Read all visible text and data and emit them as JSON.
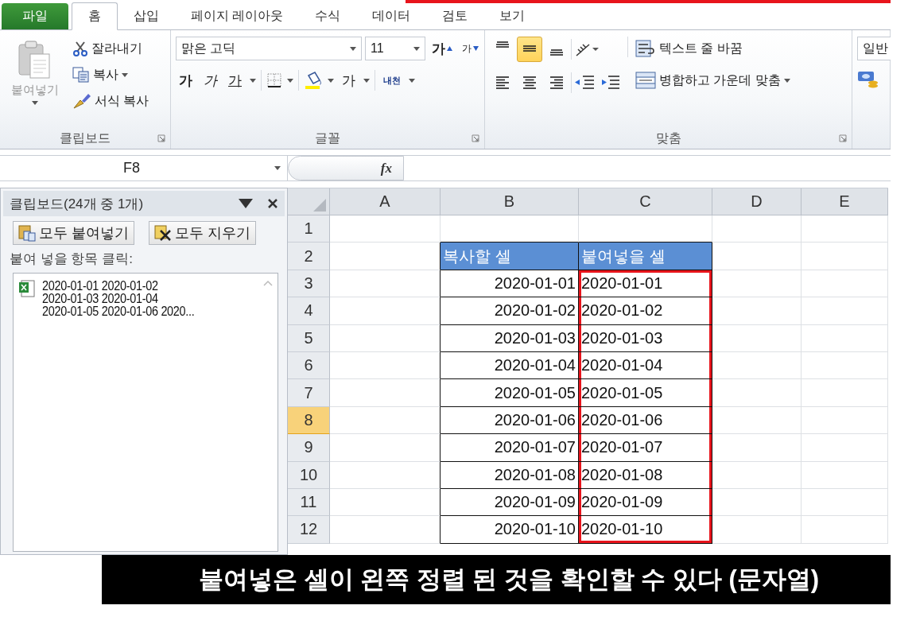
{
  "tabs": [
    {
      "label": "파일",
      "kind": "file",
      "selected": false
    },
    {
      "label": "홈",
      "kind": "tab",
      "selected": true
    },
    {
      "label": "삽입",
      "kind": "tab",
      "selected": false
    },
    {
      "label": "페이지 레이아웃",
      "kind": "tab",
      "selected": false
    },
    {
      "label": "수식",
      "kind": "tab",
      "selected": false
    },
    {
      "label": "데이터",
      "kind": "tab",
      "selected": false
    },
    {
      "label": "검토",
      "kind": "tab",
      "selected": false
    },
    {
      "label": "보기",
      "kind": "tab",
      "selected": false
    }
  ],
  "clipboard_group": {
    "label": "클립보드",
    "paste": {
      "label": "붙여넣기",
      "disabled": true
    },
    "actions": [
      {
        "label": "잘라내기",
        "kind": "cut",
        "dropdown": false
      },
      {
        "label": "복사",
        "kind": "copy",
        "dropdown": true
      },
      {
        "label": "서식 복사",
        "kind": "brush",
        "dropdown": false
      }
    ]
  },
  "font_group": {
    "label": "글꼴",
    "font_name": "맑은 고딕",
    "font_size": "11",
    "grow": "가",
    "shrink": "가",
    "styles": [
      {
        "label": "가",
        "kind": "bold"
      },
      {
        "label": "가",
        "kind": "italic"
      },
      {
        "label": "가",
        "kind": "underline"
      }
    ],
    "font_color": "가",
    "phonetic": "내천"
  },
  "alignment_group": {
    "label": "맞춤",
    "vertical": [
      {
        "kind": "top",
        "selected": false
      },
      {
        "kind": "middle",
        "selected": true
      },
      {
        "kind": "bottom",
        "selected": false
      }
    ],
    "horizontal": [
      {
        "kind": "left"
      },
      {
        "kind": "center"
      },
      {
        "kind": "right"
      }
    ],
    "wrap_text": "텍스트 줄 바꿈",
    "merge": "병합하고 가운데 맞춤"
  },
  "number_group": {
    "format": "일반"
  },
  "formula_bar": {
    "name_box": "F8",
    "fx": "fx"
  },
  "clipboard_pane": {
    "title": "클립보드(24개 중 1개)",
    "paste_all": "모두 붙여넣기",
    "clear_all": "모두 지우기",
    "hint": "붙여 넣을 항목 클릭:",
    "items": [
      {
        "lines": [
          "2020-01-01 2020-01-02",
          "2020-01-03 2020-01-04",
          "2020-01-05 2020-01-06 2020..."
        ]
      }
    ]
  },
  "sheet": {
    "columns": [
      "A",
      "B",
      "C",
      "D",
      "E"
    ],
    "rows": [
      {
        "number": "1",
        "selected": false
      },
      {
        "number": "2",
        "selected": false,
        "column_b": {
          "text": "복사할 셀",
          "kind": "header"
        },
        "column_c": {
          "text": "붙여넣을 셀",
          "kind": "header",
          "outlined": false
        }
      },
      {
        "number": "3",
        "selected": false,
        "column_b": {
          "text": "2020-01-01",
          "kind": "number"
        },
        "column_c": {
          "text": "2020-01-01",
          "kind": "text",
          "outlined": true
        }
      },
      {
        "number": "4",
        "selected": false,
        "column_b": {
          "text": "2020-01-02",
          "kind": "number"
        },
        "column_c": {
          "text": "2020-01-02",
          "kind": "text",
          "outlined": true
        }
      },
      {
        "number": "5",
        "selected": false,
        "column_b": {
          "text": "2020-01-03",
          "kind": "number"
        },
        "column_c": {
          "text": "2020-01-03",
          "kind": "text",
          "outlined": true
        }
      },
      {
        "number": "6",
        "selected": false,
        "column_b": {
          "text": "2020-01-04",
          "kind": "number"
        },
        "column_c": {
          "text": "2020-01-04",
          "kind": "text",
          "outlined": true
        }
      },
      {
        "number": "7",
        "selected": false,
        "column_b": {
          "text": "2020-01-05",
          "kind": "number"
        },
        "column_c": {
          "text": "2020-01-05",
          "kind": "text",
          "outlined": true
        }
      },
      {
        "number": "8",
        "selected": true,
        "column_b": {
          "text": "2020-01-06",
          "kind": "number"
        },
        "column_c": {
          "text": "2020-01-06",
          "kind": "text",
          "outlined": true
        }
      },
      {
        "number": "9",
        "selected": false,
        "column_b": {
          "text": "2020-01-07",
          "kind": "number"
        },
        "column_c": {
          "text": "2020-01-07",
          "kind": "text",
          "outlined": true
        }
      },
      {
        "number": "10",
        "selected": false,
        "column_b": {
          "text": "2020-01-08",
          "kind": "number"
        },
        "column_c": {
          "text": "2020-01-08",
          "kind": "text",
          "outlined": true
        }
      },
      {
        "number": "11",
        "selected": false,
        "column_b": {
          "text": "2020-01-09",
          "kind": "number"
        },
        "column_c": {
          "text": "2020-01-09",
          "kind": "text",
          "outlined": true
        }
      },
      {
        "number": "12",
        "selected": false,
        "column_b": {
          "text": "2020-01-10",
          "kind": "number"
        },
        "column_c": {
          "text": "2020-01-10",
          "kind": "text",
          "outlined": true
        }
      }
    ]
  },
  "caption": "붙여넣은 셀이 왼쪽 정렬 된 것을 확인할 수 있다 (문자열)"
}
